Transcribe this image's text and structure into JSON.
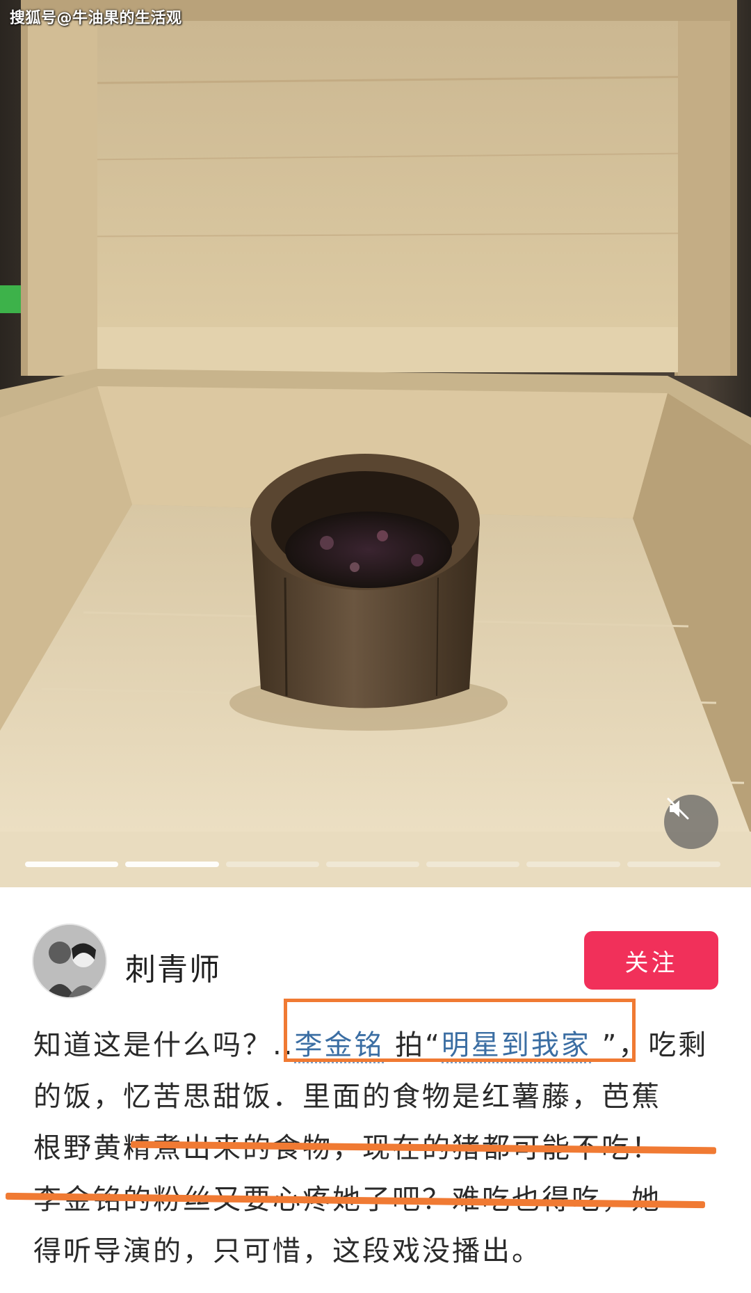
{
  "watermark": {
    "text": "搜狐号@牛油果的生活观"
  },
  "media": {
    "description_icon": "wooden-box-photo",
    "mute_icon": "speaker-muted-icon",
    "progress": {
      "segments": 7,
      "current": 2
    }
  },
  "post": {
    "author": "刺青师",
    "follow_label": "关注",
    "lines": {
      "l1": {
        "prefix": "知道这是什么吗？",
        "ellipsis": "..",
        "mention": "李金铭",
        "middle": " 拍“",
        "link": "明星到我家",
        "suffix": " ”，吃剩"
      },
      "l2": "的饭，忆苦思甜饭．里面的食物是红薯藤，芭蕉",
      "l3": "根野黄精煮出来的食物，现在的猪都可能不吃！",
      "l4": "李金铭的粉丝又要心疼她了吧？难吃也得吃，她",
      "l5": "得听导演的，只可惜，这段戏没播出。"
    }
  },
  "colors": {
    "follow_button": "#f1305a",
    "annotation": "#f07a33",
    "link": "#3b6ea3"
  }
}
